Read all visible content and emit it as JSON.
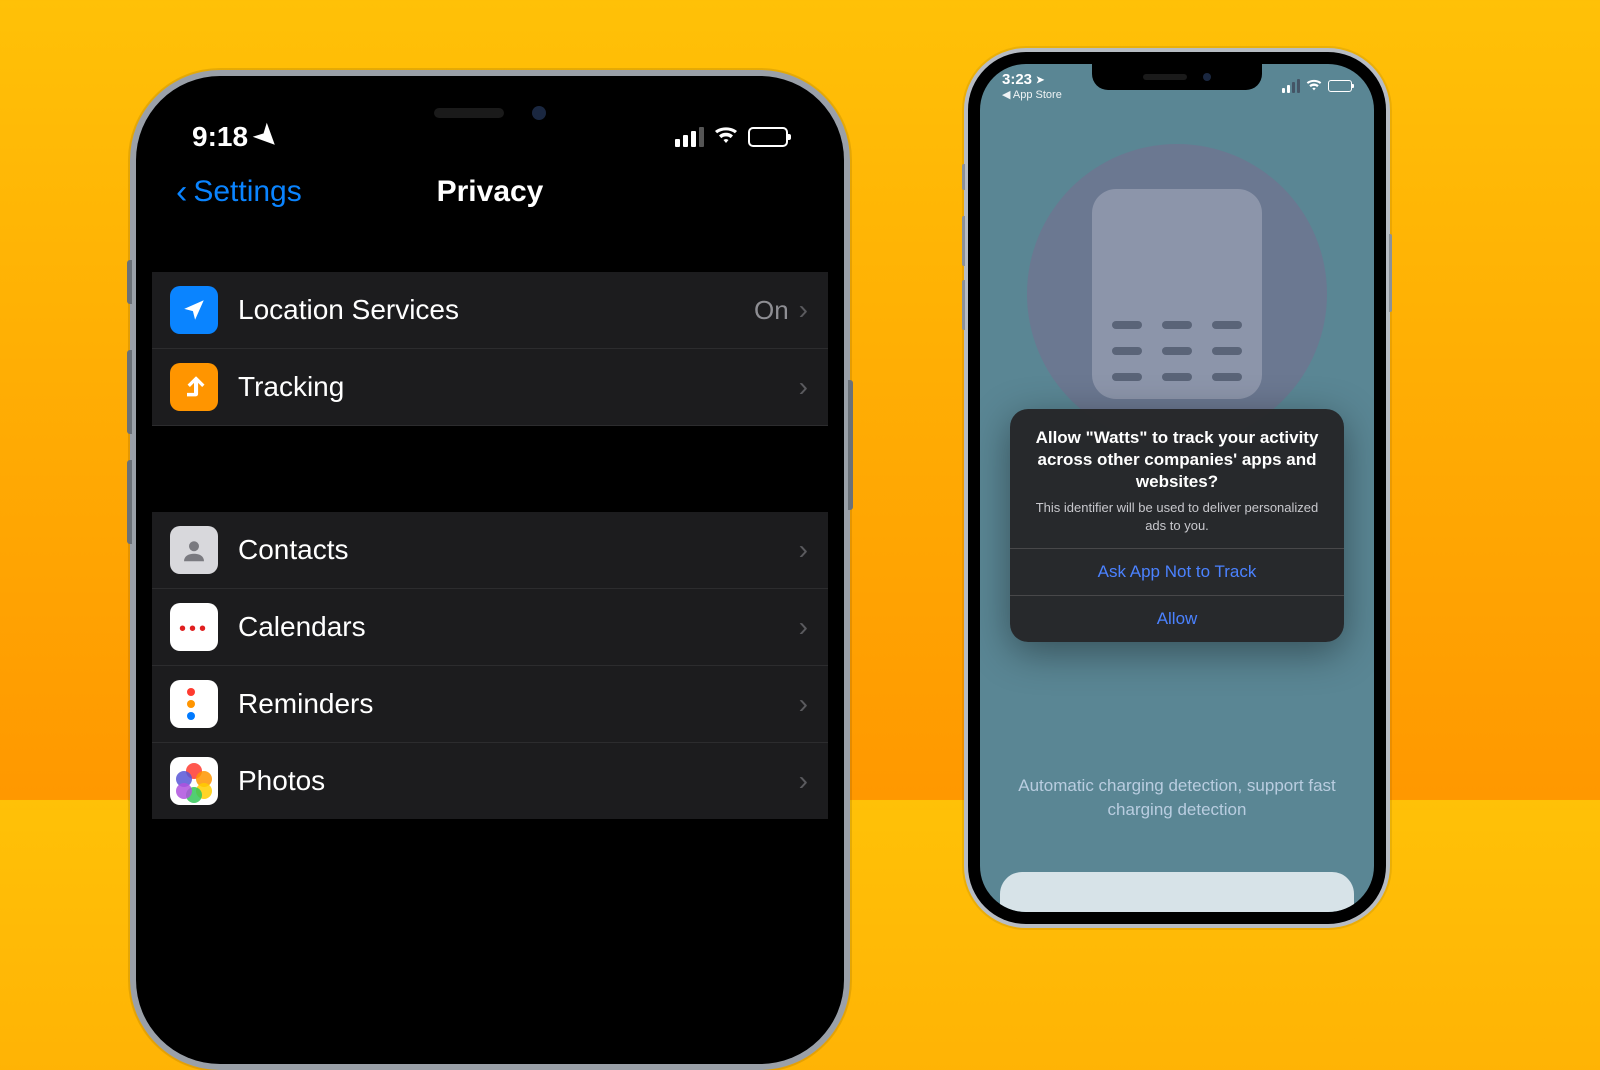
{
  "left": {
    "status": {
      "time": "9:18"
    },
    "nav": {
      "back": "Settings",
      "title": "Privacy"
    },
    "rows": {
      "location": {
        "label": "Location Services",
        "value": "On"
      },
      "tracking": {
        "label": "Tracking"
      },
      "contacts": {
        "label": "Contacts"
      },
      "calendars": {
        "label": "Calendars"
      },
      "reminders": {
        "label": "Reminders"
      },
      "photos": {
        "label": "Photos"
      }
    }
  },
  "right": {
    "status": {
      "time": "3:23",
      "back_app": "◀ App Store"
    },
    "alert": {
      "title": "Allow \"Watts\" to track your activity across other companies' apps and websites?",
      "subtitle": "This identifier will be used to deliver personalized ads to you.",
      "deny": "Ask App Not to Track",
      "allow": "Allow"
    },
    "caption": "Automatic charging detection, support fast charging detection"
  }
}
